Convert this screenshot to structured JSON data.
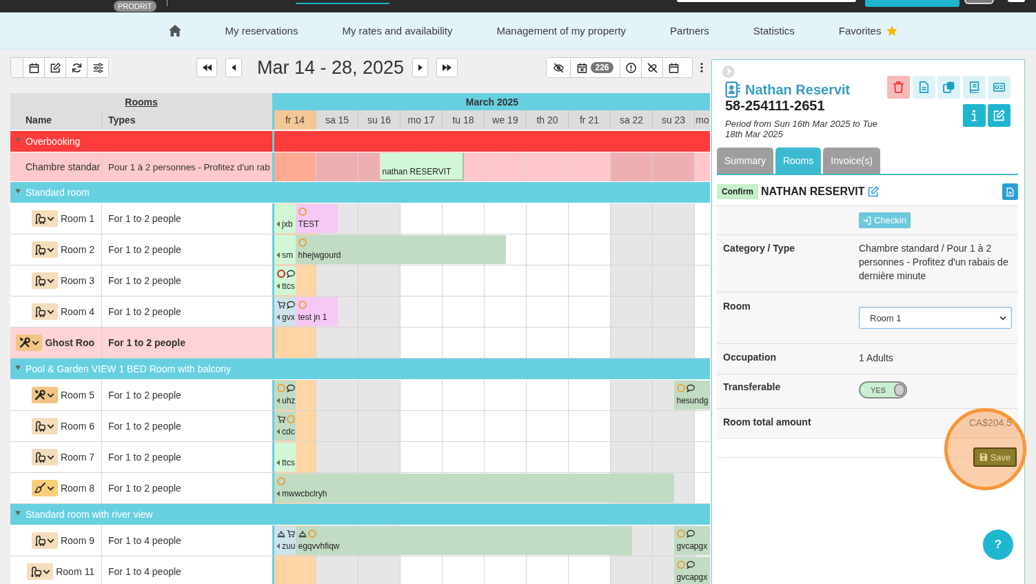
{
  "top_bar": {
    "badge": "PRODRIT"
  },
  "nav": {
    "items": [
      {
        "kind": "home"
      },
      {
        "kind": "link",
        "label": "My reservations"
      },
      {
        "kind": "link",
        "label": "My rates and availability"
      },
      {
        "kind": "link",
        "label": "Management of my property"
      },
      {
        "kind": "link",
        "label": "Partners"
      },
      {
        "kind": "link",
        "label": "Statistics"
      },
      {
        "kind": "favorites",
        "label": "Favorites"
      }
    ]
  },
  "toolbar": {
    "view_buttons": [
      {
        "kind": "calendar"
      },
      {
        "kind": "edit"
      },
      {
        "kind": "refresh"
      },
      {
        "kind": "filters"
      }
    ],
    "date_range": "Mar 14 - 28, 2025",
    "option_buttons": [
      {
        "kind": "hide_links"
      },
      {
        "kind": "cancelled",
        "count": "226"
      },
      {
        "kind": "alerts"
      },
      {
        "kind": "unlink"
      },
      {
        "kind": "calendar"
      },
      {
        "kind": "more"
      }
    ]
  },
  "grid": {
    "rooms_title": "Rooms",
    "columns": [
      "Name",
      "Types"
    ],
    "month": "March 2025",
    "days": [
      {
        "label": "fr 14",
        "highlighted": true,
        "weekend": false
      },
      {
        "label": "sa 15",
        "highlighted": false,
        "weekend": true
      },
      {
        "label": "su 16",
        "highlighted": false,
        "weekend": true
      },
      {
        "label": "mo 17",
        "highlighted": false,
        "weekend": false
      },
      {
        "label": "tu 18",
        "highlighted": false,
        "weekend": false
      },
      {
        "label": "we 19",
        "highlighted": false,
        "weekend": false
      },
      {
        "label": "th 20",
        "highlighted": false,
        "weekend": false
      },
      {
        "label": "fr 21",
        "highlighted": false,
        "weekend": false
      },
      {
        "label": "sa 22",
        "highlighted": false,
        "weekend": true
      },
      {
        "label": "su 23",
        "highlighted": false,
        "weekend": true
      },
      {
        "label": "mo",
        "highlighted": false,
        "weekend": false
      }
    ],
    "groups": [
      {
        "label": "Overbooking",
        "kind": "overbooking",
        "expanded": true,
        "rooms": [
          {
            "name": "Chambre standar",
            "type": "Pour 1 à 2 personnes - Profitez d'un rab",
            "highlighted": false,
            "nights": [
              {
                "kind": "free"
              },
              {
                "kind": "free"
              },
              {
                "kind": "free"
              },
              {
                "kind": "start"
              },
              {
                "kind": "stay"
              },
              {
                "kind": "free"
              },
              {
                "kind": "free"
              },
              {
                "kind": "free"
              },
              {
                "kind": "free"
              },
              {
                "kind": "free"
              },
              {
                "kind": "free"
              }
            ],
            "bookings": [
              {
                "label": "nathan RESERVIT",
                "selected": true,
                "color": "#d2f7d6"
              }
            ]
          }
        ]
      },
      {
        "label": "Standard room",
        "kind": "room_type",
        "expanded": true,
        "rooms": [
          {
            "name": "Room 1",
            "type": "For 1 to 2 people",
            "highlighted": false,
            "housekeeping": {
              "kind": "vacuum"
            },
            "nights": [
              {
                "kind": "stay"
              },
              {
                "kind": "start"
              },
              {
                "kind": "free"
              },
              {
                "kind": "free"
              },
              {
                "kind": "free"
              },
              {
                "kind": "free"
              },
              {
                "kind": "free"
              },
              {
                "kind": "free"
              },
              {
                "kind": "free"
              },
              {
                "kind": "free"
              },
              {
                "kind": "free"
              }
            ],
            "bookings": [
              {
                "label": "jxb",
                "selected": false,
                "color": "#d2f7d6"
              },
              {
                "label": "TEST",
                "selected": false,
                "color": "#f5c8f5",
                "icons": [
                  {
                    "kind": "ring",
                    "color": "#eea040"
                  }
                ]
              }
            ]
          },
          {
            "name": "Room 2",
            "type": "For 1 to 2 people",
            "highlighted": false,
            "housekeeping": {
              "kind": "vacuum"
            },
            "nights": [
              {
                "kind": "stay"
              },
              {
                "kind": "start"
              },
              {
                "kind": "stay"
              },
              {
                "kind": "stay"
              },
              {
                "kind": "stay"
              },
              {
                "kind": "stay"
              },
              {
                "kind": "free"
              },
              {
                "kind": "free"
              },
              {
                "kind": "free"
              },
              {
                "kind": "free"
              },
              {
                "kind": "free"
              }
            ],
            "bookings": [
              {
                "label": "sm",
                "selected": false,
                "color": "#d2f7d6"
              },
              {
                "label": "hhejwgourd",
                "selected": false,
                "color": "#c2dbc3",
                "icons": [
                  {
                    "kind": "ring",
                    "color": "#eea040"
                  }
                ]
              }
            ]
          },
          {
            "name": "Room 3",
            "type": "For 1 to 2 people",
            "highlighted": false,
            "housekeeping": {
              "kind": "vacuum"
            },
            "nights": [
              {
                "kind": "stay"
              },
              {
                "kind": "free"
              },
              {
                "kind": "free"
              },
              {
                "kind": "free"
              },
              {
                "kind": "free"
              },
              {
                "kind": "free"
              },
              {
                "kind": "free"
              },
              {
                "kind": "free"
              },
              {
                "kind": "free"
              },
              {
                "kind": "free"
              },
              {
                "kind": "free"
              }
            ],
            "bookings": [
              {
                "label": "ttcs",
                "selected": false,
                "color": "#d2f7d6",
                "icons": [
                  {
                    "kind": "ring",
                    "color": "#cc2b1d"
                  },
                  {
                    "kind": "comment"
                  }
                ]
              }
            ]
          },
          {
            "name": "Room 4",
            "type": "For 1 to 2 people",
            "highlighted": false,
            "housekeeping": {
              "kind": "vacuum"
            },
            "nights": [
              {
                "kind": "stay"
              },
              {
                "kind": "start"
              },
              {
                "kind": "free"
              },
              {
                "kind": "free"
              },
              {
                "kind": "free"
              },
              {
                "kind": "free"
              },
              {
                "kind": "free"
              },
              {
                "kind": "free"
              },
              {
                "kind": "free"
              },
              {
                "kind": "free"
              },
              {
                "kind": "free"
              }
            ],
            "bookings": [
              {
                "label": "gvx",
                "selected": false,
                "color": "#cfe3ea",
                "icons": [
                  {
                    "kind": "cart"
                  },
                  {
                    "kind": "comment"
                  }
                ]
              },
              {
                "label": "test jn 1",
                "selected": false,
                "color": "#f5c8f5",
                "icons": [
                  {
                    "kind": "ring",
                    "color": "#eea040"
                  }
                ]
              }
            ]
          },
          {
            "name": "Ghost Roo",
            "type": "For 1 to 2 people",
            "highlighted": true,
            "housekeeping": {
              "kind": "tools"
            }
          }
        ]
      },
      {
        "label": "Pool & Garden VIEW 1 BED Room with balcony",
        "kind": "room_type",
        "expanded": true,
        "rooms": [
          {
            "name": "Room 5",
            "type": "For 1 to 2 people",
            "highlighted": false,
            "housekeeping": {
              "kind": "tools"
            },
            "nights": [
              {
                "kind": "stay"
              },
              {
                "kind": "free"
              },
              {
                "kind": "free"
              },
              {
                "kind": "free"
              },
              {
                "kind": "free"
              },
              {
                "kind": "free"
              },
              {
                "kind": "free"
              },
              {
                "kind": "free"
              },
              {
                "kind": "free"
              },
              {
                "kind": "free"
              },
              {
                "kind": "start"
              }
            ],
            "bookings": [
              {
                "label": "uhz",
                "selected": false,
                "color": "#c2dbc3",
                "icons": [
                  {
                    "kind": "ring",
                    "color": "#eea040"
                  },
                  {
                    "kind": "comment"
                  }
                ]
              },
              {
                "label": "hesundg",
                "selected": false,
                "color": "#c2dbc3",
                "icons": [
                  {
                    "kind": "ring",
                    "color": "#eea040"
                  },
                  {
                    "kind": "comment"
                  }
                ]
              }
            ]
          },
          {
            "name": "Room 6",
            "type": "For 1 to 2 people",
            "highlighted": false,
            "housekeeping": {
              "kind": "vacuum"
            },
            "nights": [
              {
                "kind": "stay"
              },
              {
                "kind": "free"
              },
              {
                "kind": "free"
              },
              {
                "kind": "free"
              },
              {
                "kind": "free"
              },
              {
                "kind": "free"
              },
              {
                "kind": "free"
              },
              {
                "kind": "free"
              },
              {
                "kind": "free"
              },
              {
                "kind": "free"
              },
              {
                "kind": "free"
              }
            ],
            "bookings": [
              {
                "label": "cdc",
                "selected": false,
                "color": "#c2dbc3",
                "icons": [
                  {
                    "kind": "cart"
                  },
                  {
                    "kind": "ring",
                    "color": "#eea040"
                  }
                ]
              }
            ]
          },
          {
            "name": "Room 7",
            "type": "For 1 to 2 people",
            "highlighted": false,
            "housekeeping": {
              "kind": "vacuum"
            },
            "nights": [
              {
                "kind": "stay"
              },
              {
                "kind": "free"
              },
              {
                "kind": "free"
              },
              {
                "kind": "free"
              },
              {
                "kind": "free"
              },
              {
                "kind": "free"
              },
              {
                "kind": "free"
              },
              {
                "kind": "free"
              },
              {
                "kind": "free"
              },
              {
                "kind": "free"
              },
              {
                "kind": "free"
              }
            ],
            "bookings": [
              {
                "label": "ttcs",
                "selected": false,
                "color": "#d2f7d6"
              }
            ]
          },
          {
            "name": "Room 8",
            "type": "For 1 to 2 people",
            "highlighted": false,
            "housekeeping": {
              "kind": "brush"
            },
            "nights": [
              {
                "kind": "stay"
              },
              {
                "kind": "stay"
              },
              {
                "kind": "stay"
              },
              {
                "kind": "stay"
              },
              {
                "kind": "stay"
              },
              {
                "kind": "stay"
              },
              {
                "kind": "stay"
              },
              {
                "kind": "stay"
              },
              {
                "kind": "stay"
              },
              {
                "kind": "stay"
              },
              {
                "kind": "free"
              }
            ],
            "bookings": [
              {
                "label": "mwwcbclryh",
                "selected": false,
                "color": "#c2dbc3",
                "icons": [
                  {
                    "kind": "ring",
                    "color": "#eea040"
                  }
                ]
              }
            ]
          }
        ]
      },
      {
        "label": "Standard room with river view",
        "kind": "room_type",
        "expanded": true,
        "rooms": [
          {
            "name": "Room 9",
            "type": "For 1 to 4 people",
            "highlighted": false,
            "housekeeping": {
              "kind": "vacuum"
            },
            "nights": [
              {
                "kind": "stay"
              },
              {
                "kind": "start"
              },
              {
                "kind": "stay"
              },
              {
                "kind": "stay"
              },
              {
                "kind": "stay"
              },
              {
                "kind": "stay"
              },
              {
                "kind": "stay"
              },
              {
                "kind": "stay"
              },
              {
                "kind": "stay"
              },
              {
                "kind": "free"
              },
              {
                "kind": "start"
              }
            ],
            "bookings": [
              {
                "label": "zuu",
                "selected": false,
                "color": "#cfe3ea",
                "icons": [
                  {
                    "kind": "bell"
                  },
                  {
                    "kind": "cart"
                  }
                ]
              },
              {
                "label": "egqvvhfiqw",
                "selected": false,
                "color": "#c2dbc3",
                "icons": [
                  {
                    "kind": "bell"
                  },
                  {
                    "kind": "ring",
                    "color": "#eea040"
                  }
                ]
              },
              {
                "label": "gvcapgx",
                "selected": false,
                "color": "#c2dbc3",
                "icons": [
                  {
                    "kind": "ring",
                    "color": "#eea040"
                  },
                  {
                    "kind": "comment"
                  }
                ]
              }
            ]
          },
          {
            "name": "Room 11",
            "type": "For 1 to 4 people",
            "highlighted": false,
            "housekeeping": {
              "kind": "vacuum"
            },
            "nights": [
              {
                "kind": "free"
              },
              {
                "kind": "free"
              },
              {
                "kind": "free"
              },
              {
                "kind": "free"
              },
              {
                "kind": "free"
              },
              {
                "kind": "free"
              },
              {
                "kind": "free"
              },
              {
                "kind": "free"
              },
              {
                "kind": "free"
              },
              {
                "kind": "free"
              },
              {
                "kind": "start"
              }
            ],
            "bookings": [
              {
                "label": "gvcapgx",
                "selected": false,
                "color": "#c2dbc3",
                "icons": [
                  {
                    "kind": "ring",
                    "color": "#eea040"
                  },
                  {
                    "kind": "comment"
                  }
                ]
              }
            ]
          }
        ]
      }
    ]
  },
  "reservation": {
    "guest_name": "Nathan Reservit",
    "number": "58-254111-2651",
    "period": "Period from Sun 16th Mar 2025 to Tue 18th Mar 2025",
    "actions": [
      {
        "kind": "delete"
      },
      {
        "kind": "document"
      },
      {
        "kind": "duplicate"
      },
      {
        "kind": "register"
      },
      {
        "kind": "payment"
      },
      {
        "kind": "info"
      },
      {
        "kind": "edit"
      }
    ],
    "tabs": [
      {
        "label": "Summary",
        "selected": false
      },
      {
        "label": "Rooms",
        "selected": true
      },
      {
        "label": "Invoice(s)",
        "selected": false
      }
    ],
    "status": "Confirm",
    "room_guest": "NATHAN RESERVIT",
    "checkin_button": "Checkin",
    "fields": [
      {
        "label": "Category / Type",
        "kind": "text",
        "value": "Chambre standard / Pour 1 à 2 personnes - Profitez d'un rabais de dernière minute"
      },
      {
        "label": "Room",
        "kind": "select",
        "value": "Room 1"
      },
      {
        "label": "Occupation",
        "kind": "text",
        "value": "1 Adults"
      },
      {
        "label": "Transferable",
        "kind": "toggle",
        "on": true,
        "value": "YES"
      },
      {
        "label": "Room total amount",
        "kind": "amount",
        "value": "CA$204.5"
      }
    ],
    "save_button": "Save",
    "help_button": "?"
  }
}
